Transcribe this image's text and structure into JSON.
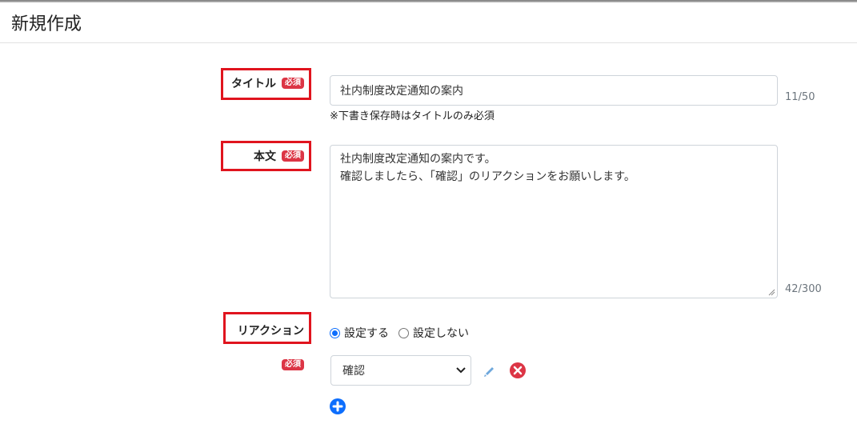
{
  "page": {
    "title": "新規作成"
  },
  "form": {
    "required_badge": "必須",
    "title_field": {
      "label": "タイトル",
      "value": "社内制度改定通知の案内",
      "counter": "11/50",
      "hint": "※下書き保存時はタイトルのみ必須"
    },
    "body_field": {
      "label": "本文",
      "lines": [
        "社内制度改定通知の案内です。",
        "確認しましたら、「確認」のリアクションをお願いします。"
      ],
      "counter": "42/300"
    },
    "reaction": {
      "label": "リアクション",
      "options": [
        {
          "label": "設定する",
          "checked": true
        },
        {
          "label": "設定しない",
          "checked": false
        }
      ],
      "select_value": "確認"
    }
  },
  "icons": {
    "edit": "pencil-icon",
    "delete": "remove-circle-icon",
    "add": "add-circle-icon",
    "select_arrow": "chevron-down-icon"
  },
  "colors": {
    "required_badge": "#dc3545",
    "highlight_box": "#e0141e",
    "radio_accent": "#0d6efd",
    "delete_icon": "#dc3545",
    "add_icon": "#0d6efd",
    "edit_icon": "#6fa8dc"
  }
}
